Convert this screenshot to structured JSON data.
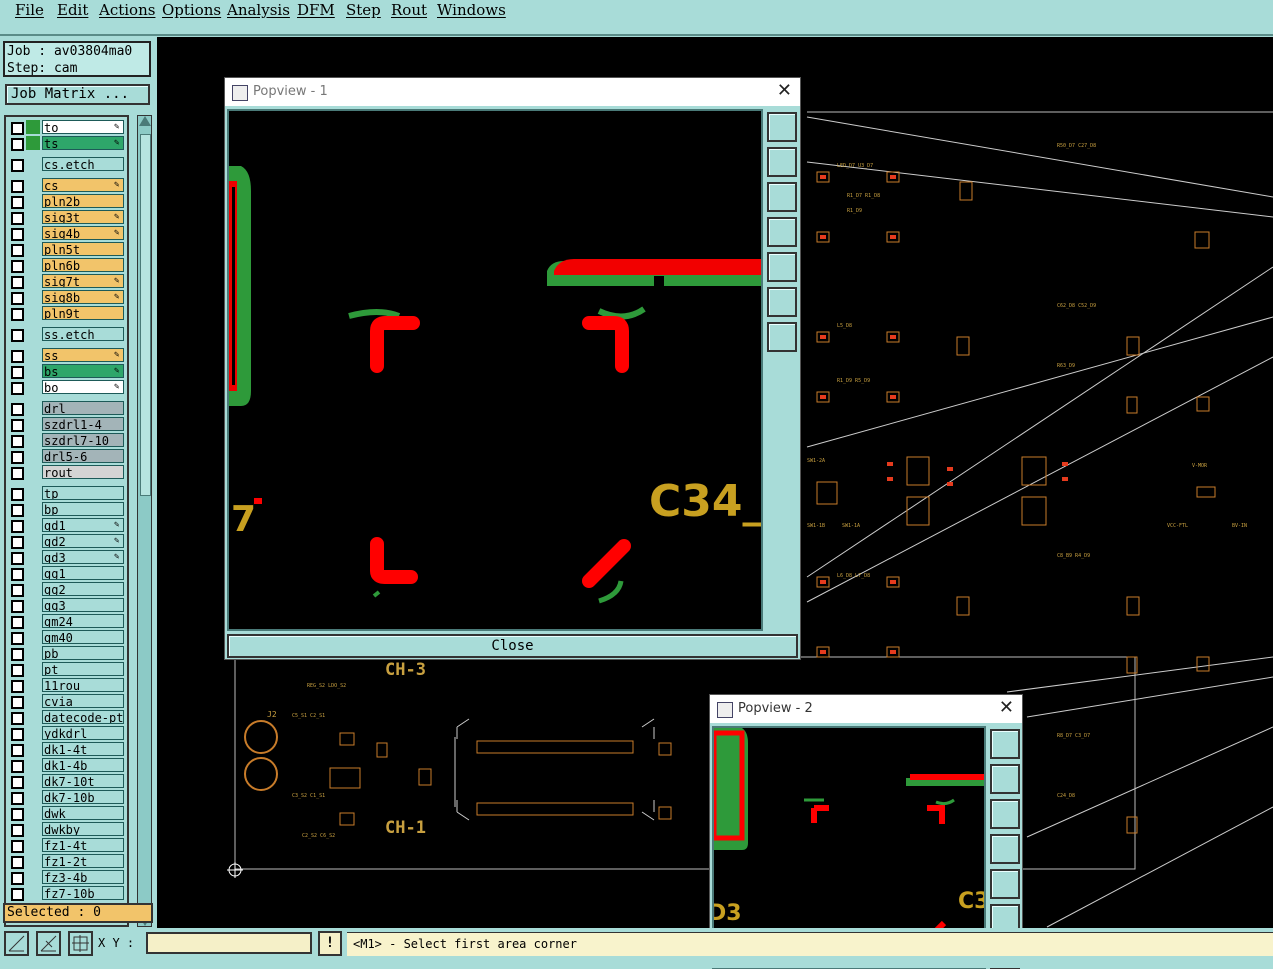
{
  "menu": [
    "File",
    "Edit",
    "Actions",
    "Options",
    "Analysis",
    "DFM",
    "Step",
    "Rout",
    "Windows"
  ],
  "job": {
    "job_line": "Job : av03804ma0",
    "step_line": "Step: cam",
    "matrix_label": "Job Matrix ..."
  },
  "layers": [
    {
      "name": "to",
      "swatch": "#2e9a3a",
      "bg": "#ffffff",
      "edit": true
    },
    {
      "name": "ts",
      "swatch": "#2e9a3a",
      "bg": "#2ea66a",
      "edit": true
    },
    {
      "name": "cs.etch",
      "swatch": "",
      "bg": "#a8dcd8",
      "edit": false
    },
    {
      "name": "cs",
      "swatch": "",
      "bg": "#f2c46a",
      "edit": true
    },
    {
      "name": "pln2b",
      "swatch": "",
      "bg": "#f2c46a",
      "edit": false
    },
    {
      "name": "sig3t",
      "swatch": "",
      "bg": "#f2c46a",
      "edit": true
    },
    {
      "name": "sig4b",
      "swatch": "",
      "bg": "#f2c46a",
      "edit": true
    },
    {
      "name": "pln5t",
      "swatch": "",
      "bg": "#f2c46a",
      "edit": false
    },
    {
      "name": "pln6b",
      "swatch": "",
      "bg": "#f2c46a",
      "edit": false
    },
    {
      "name": "sig7t",
      "swatch": "",
      "bg": "#f2c46a",
      "edit": true
    },
    {
      "name": "sig8b",
      "swatch": "",
      "bg": "#f2c46a",
      "edit": true
    },
    {
      "name": "pln9t",
      "swatch": "",
      "bg": "#f2c46a",
      "edit": false
    },
    {
      "name": "ss.etch",
      "swatch": "",
      "bg": "#a8dcd8",
      "edit": false
    },
    {
      "name": "ss",
      "swatch": "",
      "bg": "#f2c46a",
      "edit": true
    },
    {
      "name": "bs",
      "swatch": "",
      "bg": "#2ea66a",
      "edit": true
    },
    {
      "name": "bo",
      "swatch": "",
      "bg": "#ffffff",
      "edit": true
    },
    {
      "name": "drl",
      "swatch": "",
      "bg": "#a3b4b8",
      "edit": false
    },
    {
      "name": "szdrl1-4",
      "swatch": "",
      "bg": "#a3b4b8",
      "edit": false
    },
    {
      "name": "szdrl7-10",
      "swatch": "",
      "bg": "#a3b4b8",
      "edit": false
    },
    {
      "name": "drl5-6",
      "swatch": "",
      "bg": "#a3b4b8",
      "edit": false
    },
    {
      "name": "rout",
      "swatch": "",
      "bg": "#d4d4d4",
      "edit": false
    },
    {
      "name": "tp",
      "swatch": "",
      "bg": "#a8dcd8",
      "edit": false
    },
    {
      "name": "bp",
      "swatch": "",
      "bg": "#a8dcd8",
      "edit": false
    },
    {
      "name": "gd1",
      "swatch": "",
      "bg": "#a8dcd8",
      "edit": true
    },
    {
      "name": "gd2",
      "swatch": "",
      "bg": "#a8dcd8",
      "edit": true
    },
    {
      "name": "gd3",
      "swatch": "",
      "bg": "#a8dcd8",
      "edit": true
    },
    {
      "name": "gg1",
      "swatch": "",
      "bg": "#a8dcd8",
      "edit": false
    },
    {
      "name": "gg2",
      "swatch": "",
      "bg": "#a8dcd8",
      "edit": false
    },
    {
      "name": "gg3",
      "swatch": "",
      "bg": "#a8dcd8",
      "edit": false
    },
    {
      "name": "gm24",
      "swatch": "",
      "bg": "#a8dcd8",
      "edit": false
    },
    {
      "name": "gm40",
      "swatch": "",
      "bg": "#a8dcd8",
      "edit": false
    },
    {
      "name": "pb",
      "swatch": "",
      "bg": "#a8dcd8",
      "edit": false
    },
    {
      "name": "pt",
      "swatch": "",
      "bg": "#a8dcd8",
      "edit": false
    },
    {
      "name": "11rou",
      "swatch": "",
      "bg": "#a8dcd8",
      "edit": false
    },
    {
      "name": "cvia",
      "swatch": "",
      "bg": "#a8dcd8",
      "edit": false
    },
    {
      "name": "datecode-pt",
      "swatch": "",
      "bg": "#a8dcd8",
      "edit": false
    },
    {
      "name": "ydkdrl",
      "swatch": "",
      "bg": "#a8dcd8",
      "edit": false
    },
    {
      "name": "dk1-4t",
      "swatch": "",
      "bg": "#a8dcd8",
      "edit": false
    },
    {
      "name": "dk1-4b",
      "swatch": "",
      "bg": "#a8dcd8",
      "edit": false
    },
    {
      "name": "dk7-10t",
      "swatch": "",
      "bg": "#a8dcd8",
      "edit": false
    },
    {
      "name": "dk7-10b",
      "swatch": "",
      "bg": "#a8dcd8",
      "edit": false
    },
    {
      "name": "dwk",
      "swatch": "",
      "bg": "#a8dcd8",
      "edit": false
    },
    {
      "name": "dwkby",
      "swatch": "",
      "bg": "#a8dcd8",
      "edit": false
    },
    {
      "name": "fz1-4t",
      "swatch": "",
      "bg": "#a8dcd8",
      "edit": false
    },
    {
      "name": "fz1-2t",
      "swatch": "",
      "bg": "#a8dcd8",
      "edit": false
    },
    {
      "name": "fz3-4b",
      "swatch": "",
      "bg": "#a8dcd8",
      "edit": false
    },
    {
      "name": "fz7-10b",
      "swatch": "",
      "bg": "#a8dcd8",
      "edit": false
    }
  ],
  "selected_label": "Selected : 0",
  "status": {
    "xy_label": "X Y :",
    "xy_value": "",
    "prompt": "<M1> - Select first area corner"
  },
  "popview1": {
    "title": "Popview - 1",
    "close_label": "Close"
  },
  "popview2": {
    "title": "Popview - 2"
  },
  "board_labels": {
    "ch3": "CH-3",
    "ch1": "CH-1",
    "c34": "C34_",
    "j2": "J2",
    "c3": "C3",
    "d3": "D3",
    "n7": "7"
  }
}
